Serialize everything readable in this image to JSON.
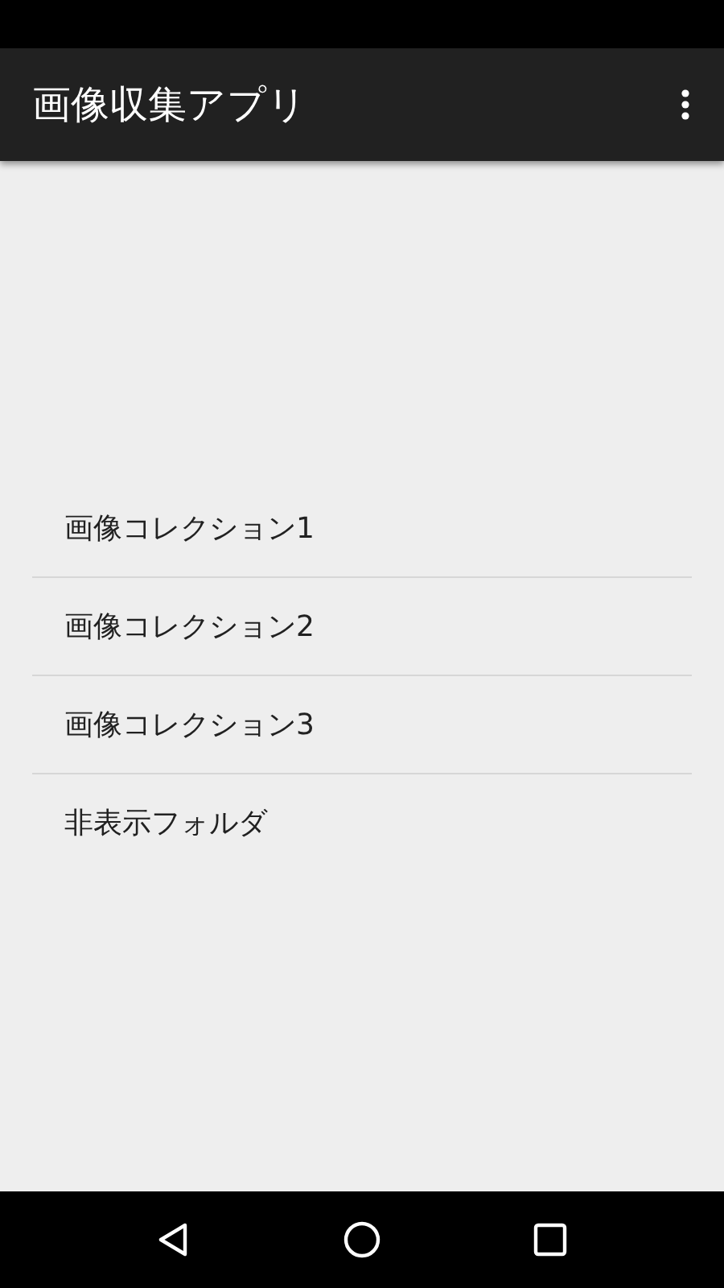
{
  "app_bar": {
    "title": "画像収集アプリ"
  },
  "list": {
    "items": [
      {
        "label": "画像コレクション1"
      },
      {
        "label": "画像コレクション2"
      },
      {
        "label": "画像コレクション3"
      },
      {
        "label": "非表示フォルダ"
      }
    ]
  }
}
